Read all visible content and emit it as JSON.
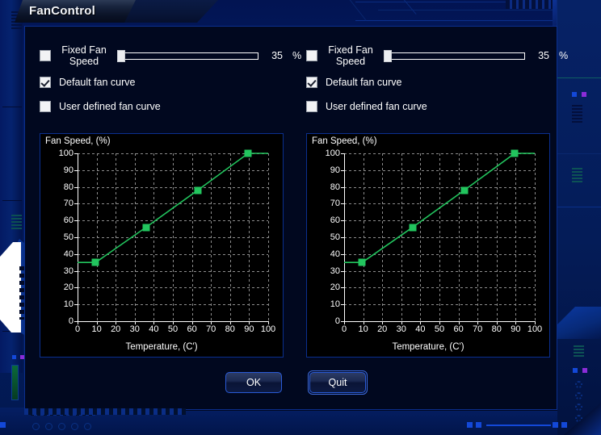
{
  "window": {
    "title": "FanControl"
  },
  "panels": [
    {
      "id": "fan1",
      "fixed_speed": {
        "checkbox_checked": false,
        "label_line1": "Fixed Fan",
        "label_line2": "Speed",
        "value": "35",
        "unit": "%",
        "slider_min": 0,
        "slider_max": 100,
        "slider_value": 0
      },
      "default_curve": {
        "label": "Default fan curve",
        "checked": true
      },
      "user_curve": {
        "label": "User defined fan curve",
        "checked": false
      },
      "chart": {
        "title": "Fan Speed, (%)",
        "xlabel": "Temperature, (C')"
      }
    },
    {
      "id": "fan2",
      "fixed_speed": {
        "checkbox_checked": false,
        "label_line1": "Fixed Fan",
        "label_line2": "Speed",
        "value": "35",
        "unit": "%",
        "slider_min": 0,
        "slider_max": 100,
        "slider_value": 0
      },
      "default_curve": {
        "label": "Default fan curve",
        "checked": true
      },
      "user_curve": {
        "label": "User defined fan curve",
        "checked": false
      },
      "chart": {
        "title": "Fan Speed, (%)",
        "xlabel": "Temperature, (C')"
      }
    }
  ],
  "buttons": {
    "ok": "OK",
    "quit": "Quit"
  },
  "colors": {
    "accent_blue": "#1348d8",
    "curve_green": "#22c55e",
    "dialog_bg": "#01081f",
    "chart_bg": "#000000",
    "frame_blue": "#0b2f8e",
    "text": "#ffffff"
  },
  "chart_data": [
    {
      "type": "line",
      "title": "Fan Speed, (%)",
      "xlabel": "Temperature, (C')",
      "ylabel": "Fan Speed, (%)",
      "xlim": [
        0,
        100
      ],
      "ylim": [
        0,
        100
      ],
      "xticks": [
        0,
        10,
        20,
        30,
        40,
        50,
        60,
        70,
        80,
        90,
        100
      ],
      "yticks": [
        0,
        10,
        20,
        30,
        40,
        50,
        60,
        70,
        80,
        90,
        100
      ],
      "grid": true,
      "legend": "none",
      "series": [
        {
          "name": "Default fan curve",
          "color": "#22c55e",
          "markers": true,
          "x": [
            0,
            9.5,
            36,
            63,
            89.5,
            100
          ],
          "y": [
            35,
            35,
            56,
            78,
            100,
            100
          ],
          "control_points": [
            {
              "x": 9.5,
              "y": 35
            },
            {
              "x": 36,
              "y": 56
            },
            {
              "x": 63,
              "y": 78
            },
            {
              "x": 89.5,
              "y": 100
            }
          ]
        }
      ]
    },
    {
      "type": "line",
      "title": "Fan Speed, (%)",
      "xlabel": "Temperature, (C')",
      "ylabel": "Fan Speed, (%)",
      "xlim": [
        0,
        100
      ],
      "ylim": [
        0,
        100
      ],
      "xticks": [
        0,
        10,
        20,
        30,
        40,
        50,
        60,
        70,
        80,
        90,
        100
      ],
      "yticks": [
        0,
        10,
        20,
        30,
        40,
        50,
        60,
        70,
        80,
        90,
        100
      ],
      "grid": true,
      "legend": "none",
      "series": [
        {
          "name": "Default fan curve",
          "color": "#22c55e",
          "markers": true,
          "x": [
            0,
            9.5,
            36,
            63,
            89.5,
            100
          ],
          "y": [
            35,
            35,
            56,
            78,
            100,
            100
          ],
          "control_points": [
            {
              "x": 9.5,
              "y": 35
            },
            {
              "x": 36,
              "y": 56
            },
            {
              "x": 63,
              "y": 78
            },
            {
              "x": 89.5,
              "y": 100
            }
          ]
        }
      ]
    }
  ]
}
